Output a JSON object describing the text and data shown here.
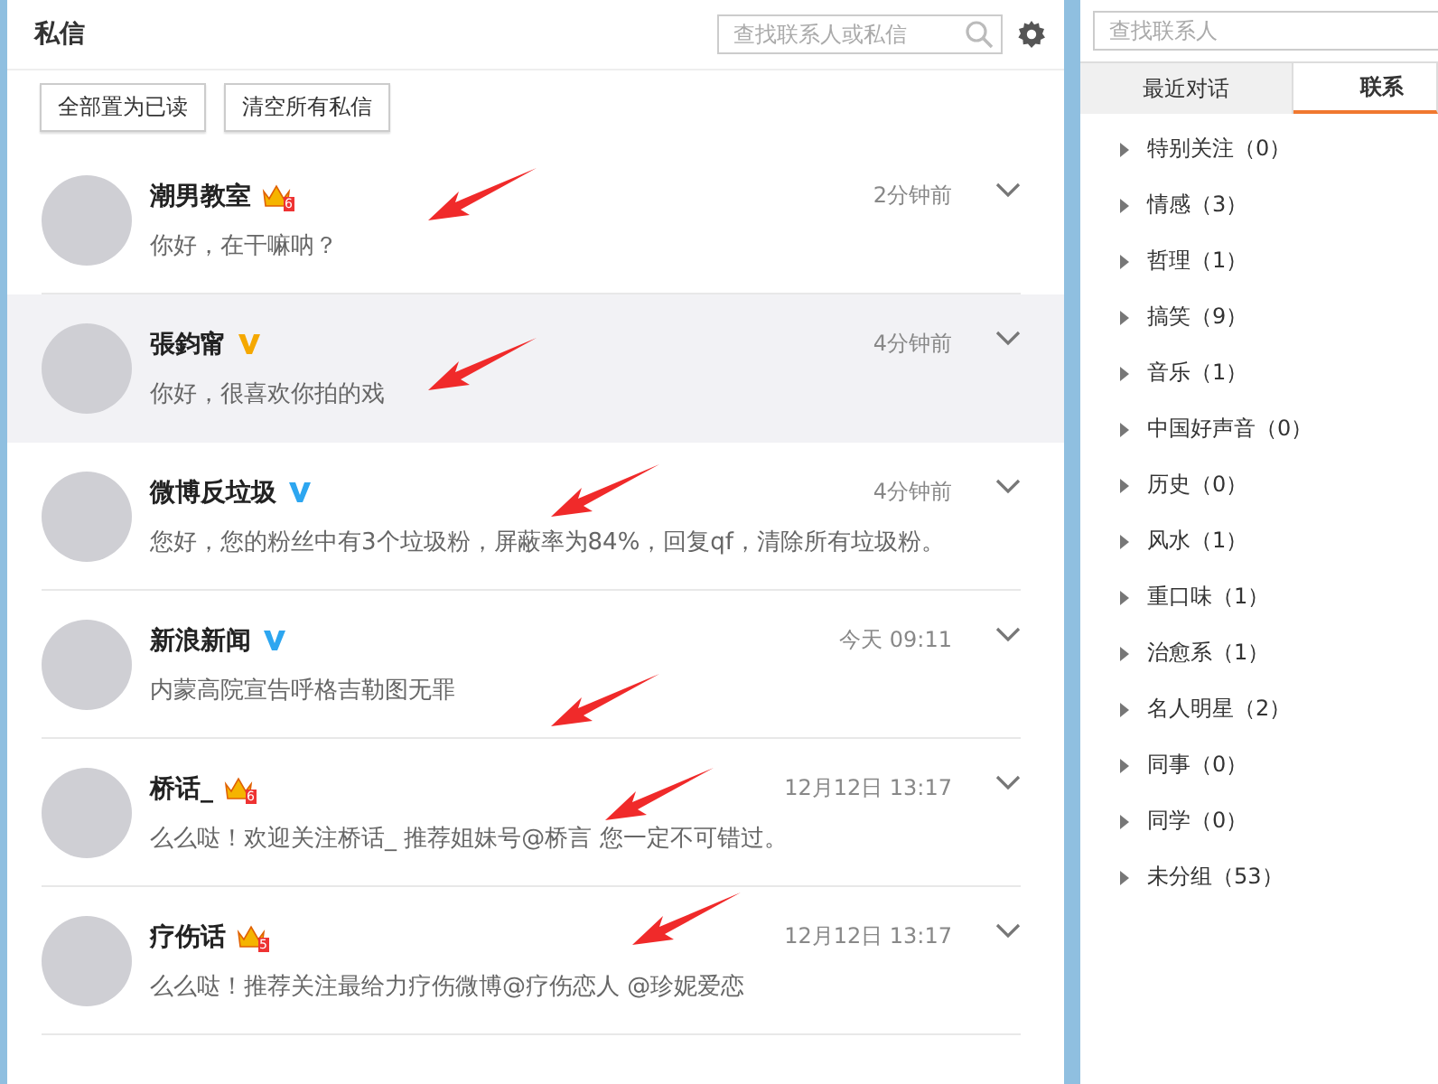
{
  "inbox": {
    "title": "私信",
    "search": {
      "placeholder": "查找联系人或私信"
    },
    "actions": [
      "全部置为已读",
      "清空所有私信"
    ],
    "conversations": [
      {
        "name": "潮男教室",
        "badge": {
          "kind": "crown",
          "level": "6"
        },
        "time": "2分钟前",
        "message": "你好，在干嘛呐？",
        "selected": false
      },
      {
        "name": "張鈞甯",
        "badge": {
          "kind": "v-gold"
        },
        "time": "4分钟前",
        "message": "你好，很喜欢你拍的戏",
        "selected": true
      },
      {
        "name": "微博反垃圾",
        "badge": {
          "kind": "v-blue"
        },
        "time": "4分钟前",
        "message": "您好，您的粉丝中有3个垃圾粉，屏蔽率为84%，回复qf，清除所有垃圾粉。",
        "selected": false
      },
      {
        "name": "新浪新闻",
        "badge": {
          "kind": "v-blue"
        },
        "time": "今天 09:11",
        "message": "内蒙高院宣告呼格吉勒图无罪",
        "selected": false
      },
      {
        "name": "桥话_",
        "badge": {
          "kind": "crown",
          "level": "6"
        },
        "time": "12月12日 13:17",
        "message": "么么哒！欢迎关注桥话_ 推荐姐妹号@桥言 您一定不可错过。",
        "selected": false
      },
      {
        "name": "疗伤话",
        "badge": {
          "kind": "crown",
          "level": "5"
        },
        "time": "12月12日 13:17",
        "message": "么么哒！推荐关注最给力疗伤微博@疗伤恋人 @珍妮爱恋",
        "selected": false
      }
    ]
  },
  "contacts": {
    "search": {
      "placeholder": "查找联系人"
    },
    "tabs": [
      {
        "label": "最近对话",
        "selected": false
      },
      {
        "label": "联系",
        "selected": true
      }
    ],
    "groups": [
      {
        "label": "特别关注（0）",
        "expanded": false
      },
      {
        "label": "情感（3）",
        "expanded": false
      },
      {
        "label": "哲理（1）",
        "expanded": false
      },
      {
        "label": "搞笑（9）",
        "expanded": false
      },
      {
        "label": "音乐（1）",
        "expanded": false
      },
      {
        "label": "中国好声音（0）",
        "expanded": false
      },
      {
        "label": "历史（0）",
        "expanded": false
      },
      {
        "label": "风水（1）",
        "expanded": false
      },
      {
        "label": "重口味（1）",
        "expanded": false
      },
      {
        "label": "治愈系（1）",
        "expanded": false
      },
      {
        "label": "名人明星（2）",
        "expanded": false
      },
      {
        "label": "同事（0）",
        "expanded": false
      },
      {
        "label": "同学（0）",
        "expanded": false
      },
      {
        "label": "未分组（53）",
        "expanded": false
      }
    ]
  }
}
